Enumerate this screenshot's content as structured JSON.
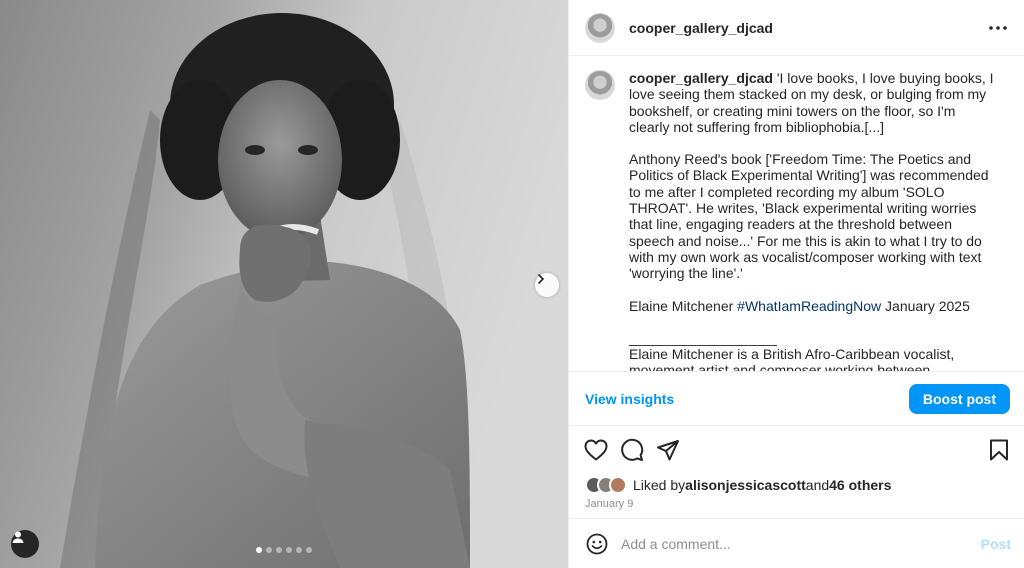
{
  "account": {
    "username": "cooper_gallery_djcad"
  },
  "caption": {
    "username": "cooper_gallery_djcad",
    "p1": " 'I love books, I love buying books, I love seeing them stacked on my desk, or bulging from my bookshelf, or creating mini towers on the floor, so I'm clearly not suffering from bibliophobia.[...]",
    "p2": "Anthony Reed's book ['Freedom Time: The Poetics and Politics of Black Experimental Writing'] was recommended to me after I completed recording my album 'SOLO THROAT'. He writes, 'Black experimental writing worries that line, engaging readers at the threshold between speech and noise...' For me this is akin to what I try to do with my own work as vocalist/composer working with text 'worrying the line'.'",
    "p3_before": "Elaine Mitchener ",
    "p3_hashtag": "#WhatIamReadingNow",
    "p3_after": " January 2025",
    "divider": "___________________",
    "p4": "Elaine Mitchener is a British Afro-Caribbean vocalist, movement artist and composer working between contemporary/experimental new music, free improvisation and sound art. She is currently a Wingate scholar and a visiting lecturer."
  },
  "insights": {
    "view_label": "View insights",
    "boost_label": "Boost post"
  },
  "likes": {
    "prefix": "Liked by ",
    "user": "alisonjessicascott",
    "middle": " and ",
    "others": "46 others"
  },
  "date": "January 9",
  "comment": {
    "placeholder": "Add a comment...",
    "post_label": "Post"
  },
  "carousel": {
    "slide_count": 6,
    "active_index": 0
  },
  "colors": {
    "accent": "#0095f6",
    "hashtag": "#00376b",
    "muted": "#8e8e8e",
    "post_disabled": "#b2dffc"
  },
  "icons": [
    "more-options-icon",
    "chevron-right-icon",
    "tag-user-icon",
    "heart-icon",
    "comment-icon",
    "share-icon",
    "bookmark-icon",
    "emoji-icon"
  ]
}
